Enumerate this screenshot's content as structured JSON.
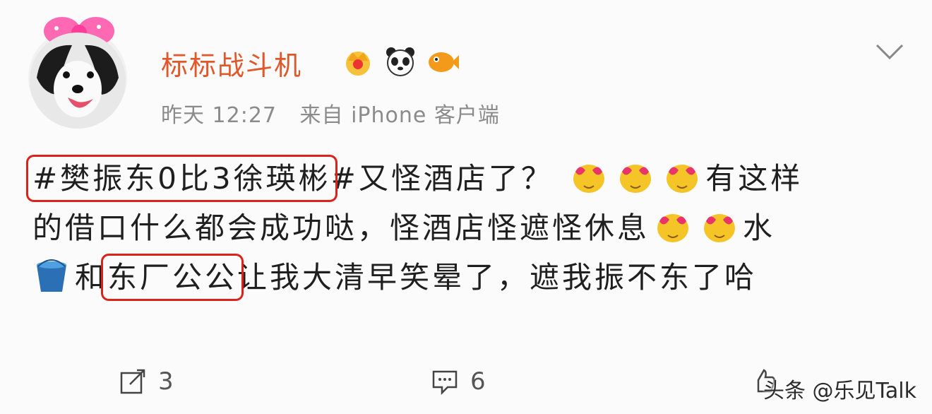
{
  "author": {
    "name": "标标战斗机",
    "badges": [
      "crown-badge-icon",
      "panda-badge-icon",
      "fish-badge-icon"
    ]
  },
  "meta": {
    "time": "昨天 12:27",
    "source": "来自 iPhone 客户端"
  },
  "post": {
    "line1": {
      "hashtag": "#樊振东0比3徐瑛彬",
      "rest": "#又怪酒店了？",
      "tail": "有这样"
    },
    "line2": {
      "text": "的借口什么都会成功哒，怪酒店怪遮怪休息",
      "tail": "水"
    },
    "line3": {
      "pre": "和",
      "highlight": "东厂公公",
      "rest": "让我大清早笑晕了，遮我振不东了哈"
    },
    "highlight_color": "#d9231b"
  },
  "actions": {
    "repost_count": "3",
    "comment_count": "6"
  },
  "watermark": "头条 @乐见Talk",
  "colors": {
    "username": "#e0572a",
    "meta": "#8b8b8b"
  }
}
